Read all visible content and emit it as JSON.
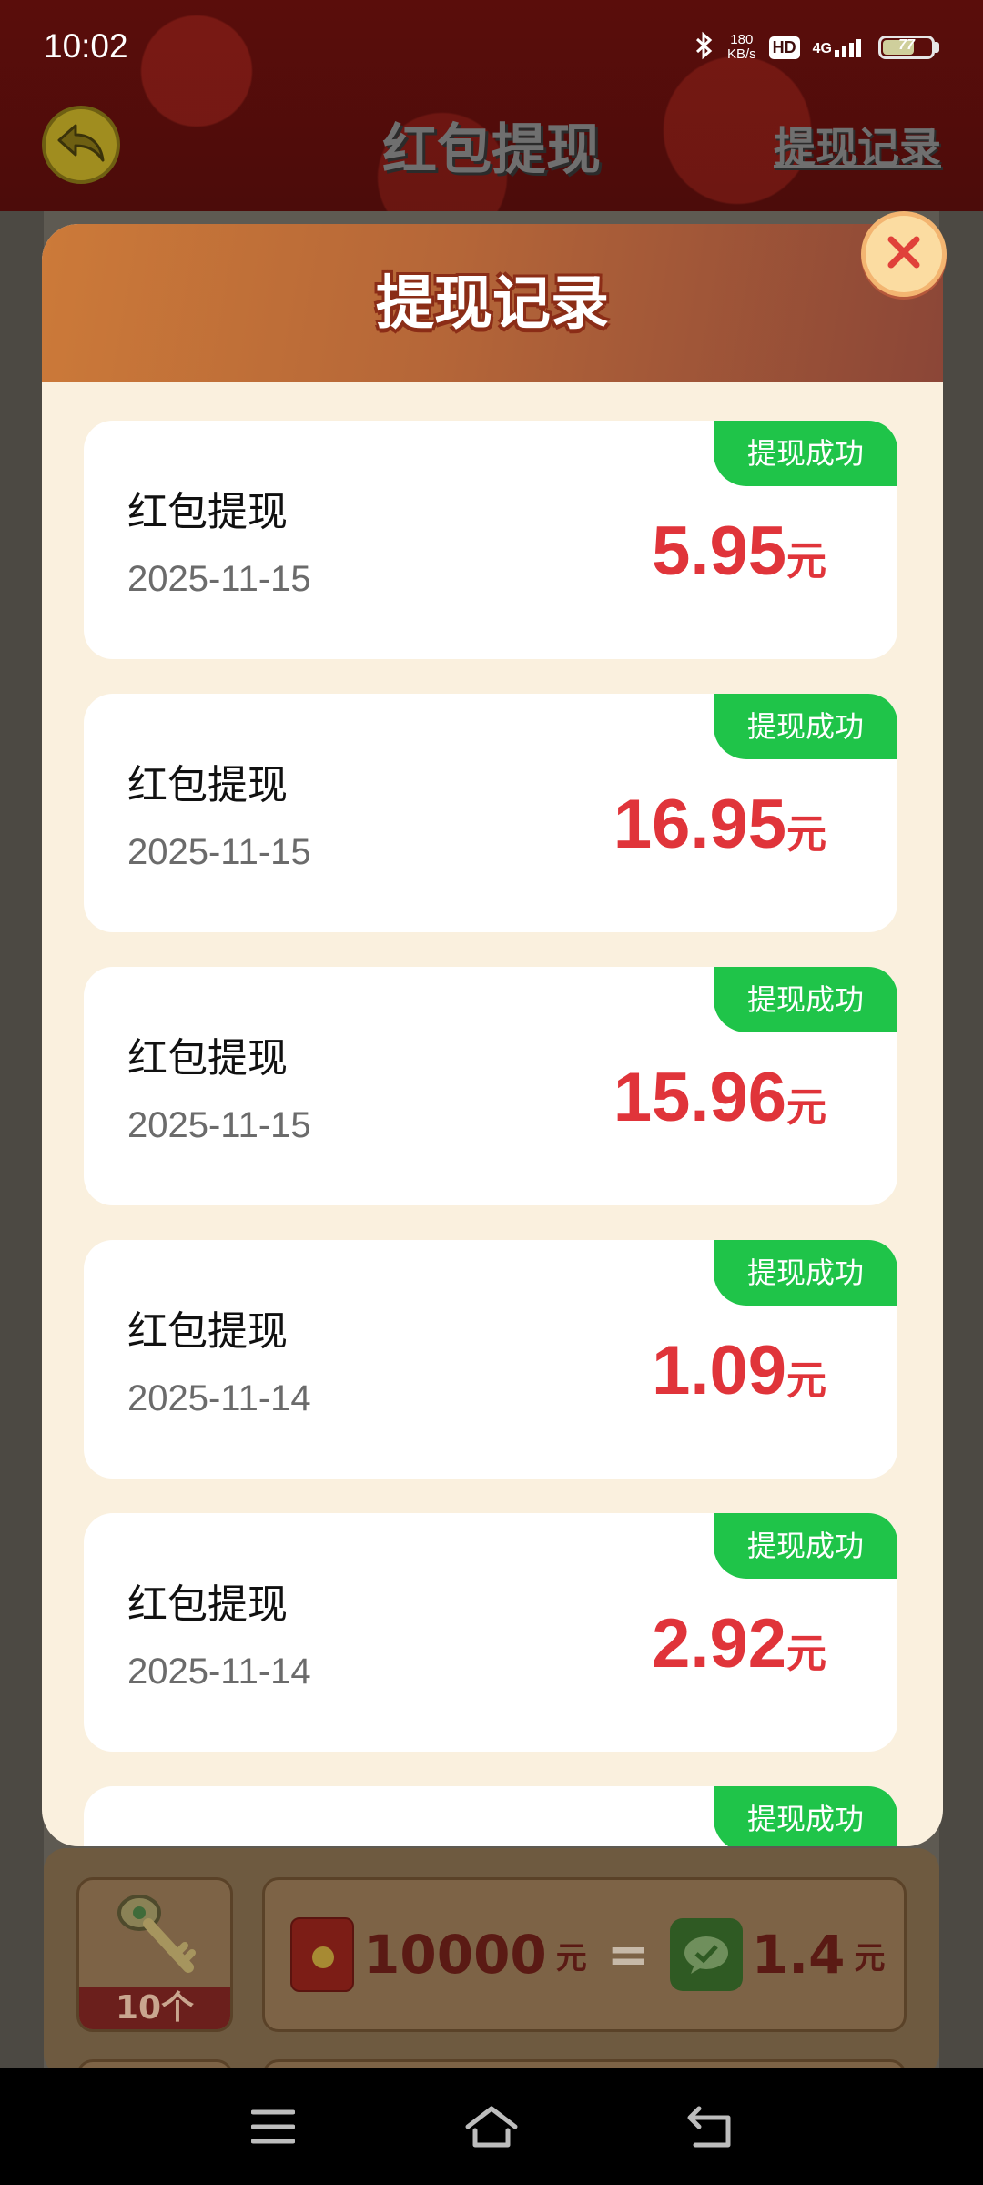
{
  "status_bar": {
    "time": "10:02",
    "speed_value": "180",
    "speed_unit": "KB/s",
    "hd": "HD",
    "network": "4G",
    "battery": "77"
  },
  "header": {
    "title": "红包提现",
    "history_link": "提现记录"
  },
  "modal": {
    "title": "提现记录",
    "records": [
      {
        "title": "红包提现",
        "date": "2025-11-15",
        "amount": "5.95",
        "unit": "元",
        "status": "提现成功"
      },
      {
        "title": "红包提现",
        "date": "2025-11-15",
        "amount": "16.95",
        "unit": "元",
        "status": "提现成功"
      },
      {
        "title": "红包提现",
        "date": "2025-11-15",
        "amount": "15.96",
        "unit": "元",
        "status": "提现成功"
      },
      {
        "title": "红包提现",
        "date": "2025-11-14",
        "amount": "1.09",
        "unit": "元",
        "status": "提现成功"
      },
      {
        "title": "红包提现",
        "date": "2025-11-14",
        "amount": "2.92",
        "unit": "元",
        "status": "提现成功"
      },
      {
        "title": "",
        "date": "",
        "amount": "",
        "unit": "",
        "status": "提现成功"
      }
    ]
  },
  "bottom": {
    "item_count": "10个",
    "rate_left_value": "10000",
    "rate_left_unit": "元",
    "rate_equals": "=",
    "rate_right_value": "1.4",
    "rate_right_unit": "元"
  },
  "colors": {
    "accent_red": "#e0343a",
    "badge_green": "#1fc449",
    "header_orange": "#cc7a39"
  }
}
